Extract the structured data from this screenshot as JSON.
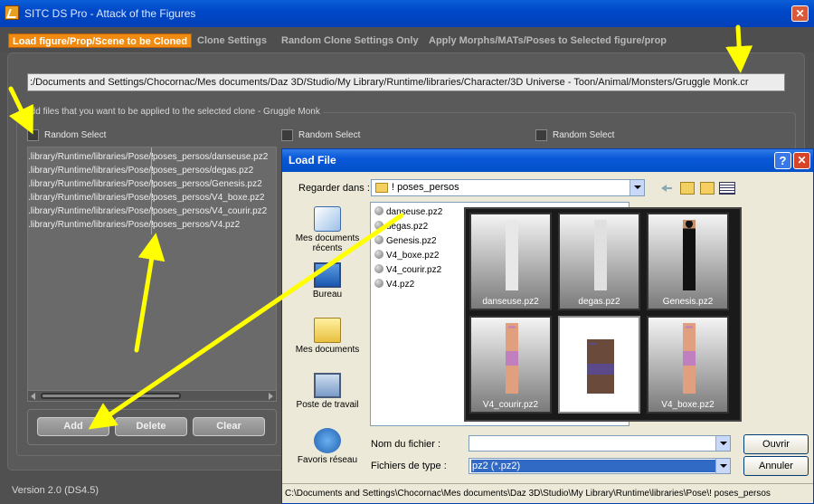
{
  "window": {
    "title": "SITC DS Pro - Attack of the Figures",
    "close_glyph": "✕"
  },
  "tabs": [
    {
      "label": "Load figure/Prop/Scene to be Cloned",
      "active": true
    },
    {
      "label": "Clone Settings",
      "active": false
    },
    {
      "label": "Random Clone Settings Only",
      "active": false
    },
    {
      "label": "Apply Morphs/MATs/Poses to Selected figure/prop",
      "active": false
    }
  ],
  "main": {
    "path": ":/Documents and Settings/Chocornac/Mes documents/Daz 3D/Studio/My Library/Runtime/libraries/Character/3D Universe - Toon/Animal/Monsters/Gruggle Monk.cr",
    "group_label": "Add files that you want to be applied to the selected clone - Gruggle Monk",
    "random_select": [
      "Random Select",
      "Random Select",
      "Random Select"
    ],
    "files_left": [
      ".library/Runtime/libraries/Pose/!",
      ".library/Runtime/libraries/Pose/!",
      ".library/Runtime/libraries/Pose/!",
      ".library/Runtime/libraries/Pose/!",
      ".library/Runtime/libraries/Pose/!",
      ".library/Runtime/libraries/Pose/!"
    ],
    "files_right": [
      "poses_persos/danseuse.pz2",
      "poses_persos/degas.pz2",
      "poses_persos/Genesis.pz2",
      "poses_persos/V4_boxe.pz2",
      "poses_persos/V4_courir.pz2",
      "poses_persos/V4.pz2"
    ],
    "buttons": {
      "add": "Add",
      "delete": "Delete",
      "clear": "Clear"
    }
  },
  "version": "Version 2.0 (DS4.5)",
  "dialog": {
    "title": "Load File",
    "help_glyph": "?",
    "close_glyph": "✕",
    "lookin_label": "Regarder dans :",
    "lookin_value": "! poses_persos",
    "places": [
      "Mes documents récents",
      "Bureau",
      "Mes documents",
      "Poste de travail",
      "Favoris réseau"
    ],
    "files": [
      "danseuse.pz2",
      "degas.pz2",
      "Genesis.pz2",
      "V4_boxe.pz2",
      "V4_courir.pz2",
      "V4.pz2"
    ],
    "thumbnails": [
      "danseuse.pz2",
      "degas.pz2",
      "Genesis.pz2",
      "V4_courir.pz2",
      "V4.pz2",
      "V4_boxe.pz2"
    ],
    "filename_label": "Nom du fichier :",
    "filename_value": "",
    "filetype_label": "Fichiers de type :",
    "filetype_value": "pz2 (*.pz2)",
    "open_label": "Ouvrir",
    "cancel_label": "Annuler",
    "status_path": "C:\\Documents and Settings\\Chocornac\\Mes documents\\Daz 3D\\Studio\\My Library\\Runtime\\libraries\\Pose\\! poses_persos"
  },
  "colors": {
    "active_tab": "#f08a10",
    "annotation_arrow": "#ffff00",
    "xp_title": "#0a58d8"
  }
}
